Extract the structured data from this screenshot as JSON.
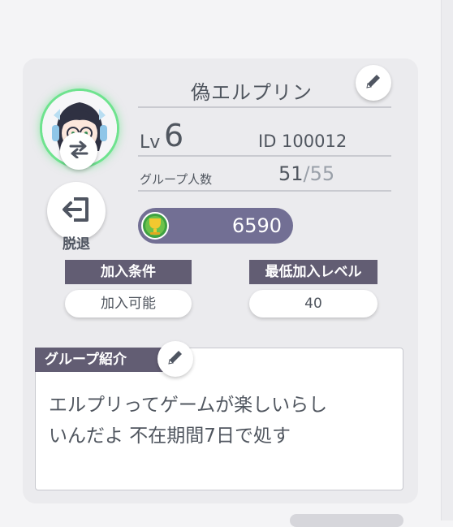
{
  "profile": {
    "name": "偽エルプリン",
    "lv_label": "Lv",
    "lv_value": "6",
    "id_text": "ID 100012",
    "members_label": "グループ人数",
    "members_current": "51",
    "members_slash": "/",
    "members_max": "55",
    "score": "6590",
    "leave_label": "脱退"
  },
  "conditions": {
    "join_condition_label": "加入条件",
    "join_condition_value": "加入可能",
    "min_level_label": "最低加入レベル",
    "min_level_value": "40"
  },
  "description": {
    "label": "グループ紹介",
    "text": "エルプリってゲームが楽しいらし\nいんだよ 不在期間7日で処す"
  },
  "icons": {
    "edit_name": "pencil-icon",
    "edit_description": "pencil-icon",
    "swap": "swap-arrows-icon",
    "leave": "exit-door-icon",
    "score": "trophy-icon"
  },
  "colors": {
    "avatar_glow": "#6ee38e",
    "score_pill": "#726f94",
    "tag_bg": "#625d73",
    "text": "#50565f"
  }
}
